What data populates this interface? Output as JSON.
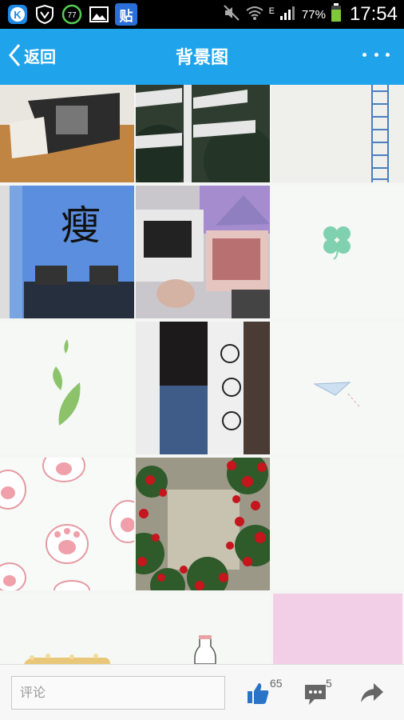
{
  "status_bar": {
    "battery_percent": "77%",
    "network_letter": "E",
    "time": "17:54",
    "app_badge_text": "贴"
  },
  "nav": {
    "back_label": "返回",
    "title": "背景图"
  },
  "grid_tiles": [
    {
      "name": "photo-book-table"
    },
    {
      "name": "photo-signposts-forest"
    },
    {
      "name": "photo-blue-ladder"
    },
    {
      "name": "photo-shou-character-building",
      "text": "瘦"
    },
    {
      "name": "photo-postcards-laptop"
    },
    {
      "name": "illustration-clover"
    },
    {
      "name": "illustration-falling-leaves"
    },
    {
      "name": "photo-sad-face-sleeve"
    },
    {
      "name": "illustration-paper-plane"
    },
    {
      "name": "illustration-cat-paws"
    },
    {
      "name": "photo-red-roses-wall"
    },
    {
      "name": "illustration-blank-mint"
    },
    {
      "name": "illustration-bottle-crumbs"
    },
    {
      "name": "illustration-blank-mint-2"
    },
    {
      "name": "illustration-pink-grid"
    }
  ],
  "bottom_bar": {
    "comment_placeholder": "评论",
    "like_count": "65",
    "comment_count": "5"
  },
  "colors": {
    "nav_bg": "#1fa3ea",
    "status_bg": "#000000",
    "like_icon": "#2a74c8",
    "comment_icon": "#666666"
  },
  "icons": [
    "k-app-icon",
    "v-shield-icon",
    "circle-77-icon",
    "gallery-icon",
    "tieba-icon",
    "mute-icon",
    "wifi-icon",
    "signal-icon",
    "battery-icon",
    "back-chevron-icon",
    "more-icon",
    "thumbs-up-icon",
    "comment-bubble-icon",
    "share-arrow-icon"
  ]
}
